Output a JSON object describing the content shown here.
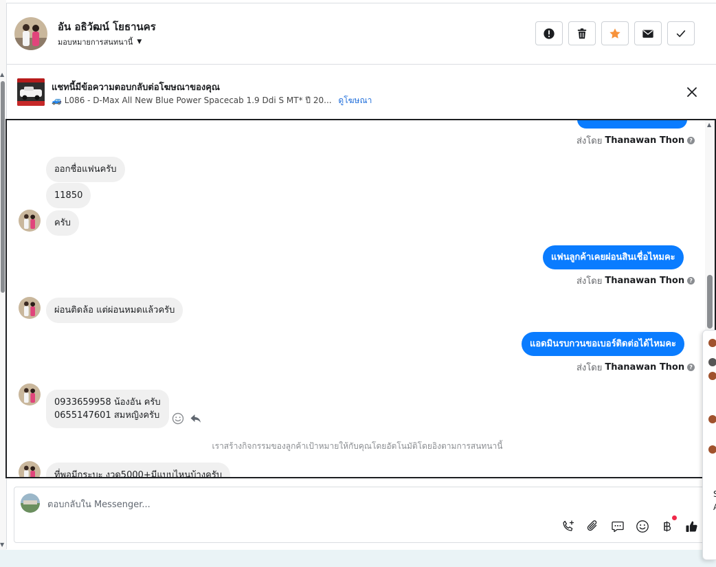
{
  "header": {
    "contact_name": "อัน อธิวัฒน์ โยธานคร",
    "assign_label": "มอบหมายการสนทนานี้",
    "actions": [
      {
        "icon": "exclamation-circle-icon"
      },
      {
        "icon": "trash-icon"
      },
      {
        "icon": "star-icon",
        "color": "#f7923b"
      },
      {
        "icon": "envelope-icon"
      },
      {
        "icon": "check-icon"
      }
    ]
  },
  "ad_banner": {
    "title": "แชทนี้มีข้อความตอบกลับต่อโฆษณาของคุณ",
    "subtitle": "🚙 L086 - D-Max All New Blue Power Spacecab 1.9 Ddi S MT* ปี 20...",
    "link": "ดูโฆษณา"
  },
  "messages": {
    "sent_by_prefix": "ส่งโดย",
    "agent_name": "Thanawan Thon",
    "items": [
      {
        "dir": "in",
        "text": "ออกชื่อแฟนครับ"
      },
      {
        "dir": "in",
        "text": "11850"
      },
      {
        "dir": "in",
        "text": "ครับ"
      },
      {
        "dir": "out",
        "text": "แฟนลูกค้าเคยผ่อนสินเชื่อไหมคะ"
      },
      {
        "dir": "in",
        "text": "ผ่อนติดล้อ แต่ผ่อนหมดแล้วครับ"
      },
      {
        "dir": "out",
        "text": "แอดมินรบกวนขอเบอร์ติดต่อได้ไหมคะ"
      },
      {
        "dir": "in",
        "text_lines": [
          "0933659958 น้องอัน ครับ",
          "0655147601 สมหญิงครับ"
        ]
      },
      {
        "dir": "in",
        "text": "ที่พอมีกระบะ งวด5000+มีแบบไหนบ้างครับ"
      }
    ],
    "system_note": "เราสร้างกิจกรรมของลูกค้าเป้าหมายให้กับคุณโดยอัตโนมัติโดยอิงตามการสนทนานี้"
  },
  "composer": {
    "placeholder": "ตอบกลับใน Messenger...",
    "tools": [
      "phone-plus-icon",
      "paperclip-icon",
      "saved-reply-icon",
      "emoji-icon",
      "baht-icon",
      "thumbs-up-icon"
    ]
  },
  "side_popup": {
    "letters": [
      "S",
      "A"
    ]
  },
  "colors": {
    "outgoing_bubble": "#0a7cff",
    "incoming_bubble": "#f0f0f0",
    "link": "#216fdb"
  }
}
